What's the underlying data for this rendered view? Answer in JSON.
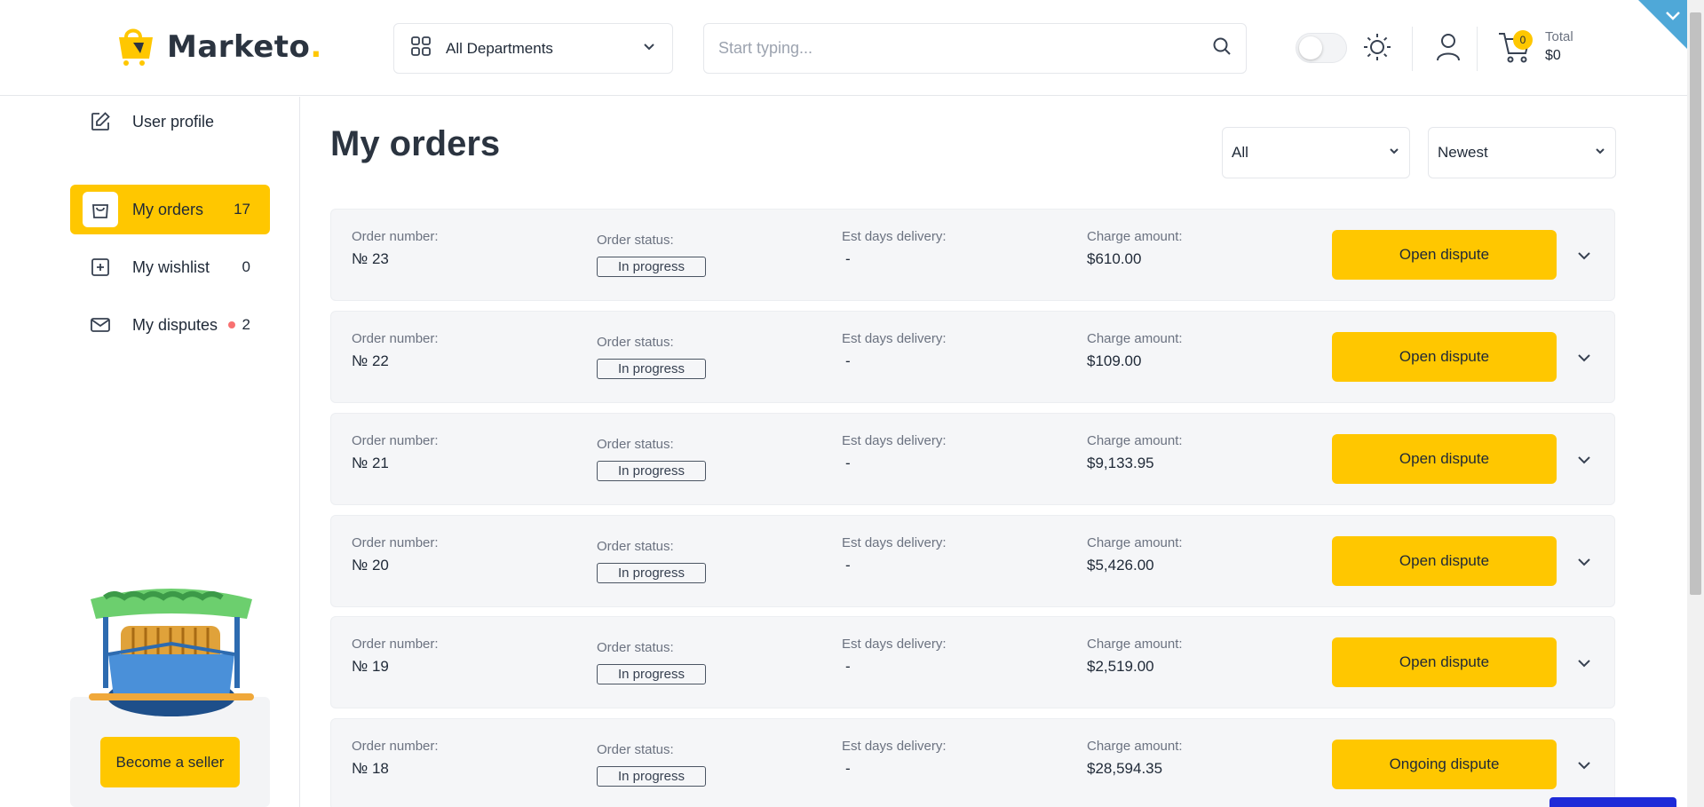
{
  "header": {
    "logo_text": "Marketo",
    "logo_dot": ".",
    "departments_label": "All Departments",
    "search_placeholder": "Start typing...",
    "cart_count": "0",
    "total_label": "Total",
    "total_value": "$0"
  },
  "sidebar": {
    "items": [
      {
        "label": "User profile",
        "count": ""
      },
      {
        "label": "My orders",
        "count": "17"
      },
      {
        "label": "My wishlist",
        "count": "0"
      },
      {
        "label": "My disputes",
        "count": "2"
      }
    ],
    "seller_button": "Become a seller"
  },
  "main": {
    "title": "My orders",
    "filter_status": "All",
    "filter_sort": "Newest",
    "labels": {
      "order_number": "Order number:",
      "order_status": "Order status:",
      "est_delivery": "Est days delivery:",
      "charge_amount": "Charge amount:"
    },
    "orders": [
      {
        "number": "№ 23",
        "status": "In progress",
        "est": "-",
        "amount": "$610.00",
        "action": "Open dispute"
      },
      {
        "number": "№ 22",
        "status": "In progress",
        "est": "-",
        "amount": "$109.00",
        "action": "Open dispute"
      },
      {
        "number": "№ 21",
        "status": "In progress",
        "est": "-",
        "amount": "$9,133.95",
        "action": "Open dispute"
      },
      {
        "number": "№ 20",
        "status": "In progress",
        "est": "-",
        "amount": "$5,426.00",
        "action": "Open dispute"
      },
      {
        "number": "№ 19",
        "status": "In progress",
        "est": "-",
        "amount": "$2,519.00",
        "action": "Open dispute"
      },
      {
        "number": "№ 18",
        "status": "In progress",
        "est": "-",
        "amount": "$28,594.35",
        "action": "Ongoing dispute"
      }
    ]
  },
  "colors": {
    "accent": "#ffc700",
    "text": "#1f2937",
    "card_bg": "#f5f6f8"
  }
}
